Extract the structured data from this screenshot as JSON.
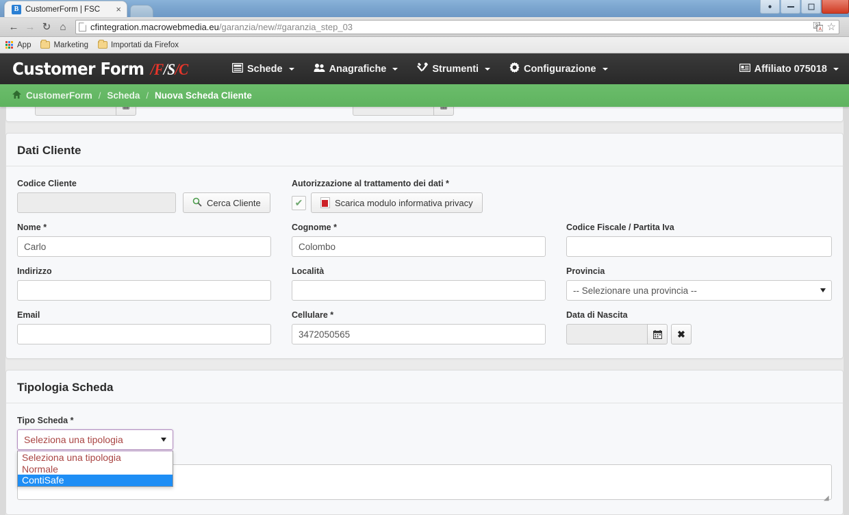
{
  "browser": {
    "tab": {
      "title": "CustomerForm | FSC",
      "favicon_letter": "B",
      "close_label": "×"
    },
    "nav": {
      "back": "←",
      "forward": "→",
      "reload": "↻",
      "home": "⌂"
    },
    "url": {
      "domain": "cfintegration.macrowebmedia.eu",
      "path": "/garanzia/new/#garanzia_step_03"
    },
    "omni_icons": {
      "translate": "translate-icon",
      "star": "☆"
    },
    "bookmarks": [
      {
        "label": "App",
        "icon": "apps-grid-icon"
      },
      {
        "label": "Marketing",
        "icon": "folder-icon"
      },
      {
        "label": "Importati da Firefox",
        "icon": "folder-icon"
      }
    ],
    "window_controls": {
      "person": "●",
      "minimize": "minimize-icon",
      "maximize": "maximize-icon",
      "close": "×"
    }
  },
  "app": {
    "brand": {
      "name": "Customer Form",
      "f": "/F",
      "s": "/S",
      "c": "/C"
    },
    "nav_items": [
      {
        "label": "Schede",
        "icon": "cards-icon",
        "has_caret": true
      },
      {
        "label": "Anagrafiche",
        "icon": "users-icon",
        "has_caret": true
      },
      {
        "label": "Strumenti",
        "icon": "tools-icon",
        "has_caret": true
      },
      {
        "label": "Configurazione",
        "icon": "gear-icon",
        "has_caret": true
      }
    ],
    "user_menu": {
      "label": "Affiliato 075018",
      "icon": "id-card-icon"
    },
    "breadcrumb": [
      {
        "label": "CustomerForm",
        "active": false
      },
      {
        "label": "Scheda",
        "active": false
      },
      {
        "label": "Nuova Scheda Cliente",
        "active": true
      }
    ],
    "breadcrumb_separator": "/"
  },
  "dati_cliente": {
    "title": "Dati Cliente",
    "codice_cliente": {
      "label": "Codice Cliente",
      "value": "",
      "placeholder": ""
    },
    "cerca_cliente_button": "Cerca Cliente",
    "autorizzazione": {
      "label": "Autorizzazione al trattamento dei dati *",
      "checked": true,
      "check_glyph": "✔"
    },
    "scarica_button": "Scarica modulo informativa privacy",
    "nome": {
      "label": "Nome *",
      "value": "Carlo"
    },
    "cognome": {
      "label": "Cognome *",
      "value": "Colombo"
    },
    "codice_fiscale": {
      "label": "Codice Fiscale / Partita Iva",
      "value": ""
    },
    "indirizzo": {
      "label": "Indirizzo",
      "value": ""
    },
    "localita": {
      "label": "Località",
      "value": ""
    },
    "provincia": {
      "label": "Provincia",
      "selected": "-- Selezionare una provincia --"
    },
    "email": {
      "label": "Email",
      "value": ""
    },
    "cellulare": {
      "label": "Cellulare *",
      "value": "3472050565"
    },
    "data_nascita": {
      "label": "Data di Nascita",
      "value": "",
      "calendar_glyph": "▦",
      "clear_glyph": "✖"
    }
  },
  "tipologia_scheda": {
    "title": "Tipologia Scheda",
    "tipo_scheda": {
      "label": "Tipo Scheda *",
      "selected": "Seleziona una tipologia",
      "open": true,
      "options": [
        {
          "label": "Seleziona una tipologia",
          "highlighted": false
        },
        {
          "label": "Normale",
          "highlighted": false
        },
        {
          "label": "ContiSafe",
          "highlighted": true
        }
      ]
    },
    "note": {
      "value": ""
    }
  },
  "clipped_panel": {
    "field_a": {
      "value": "",
      "calendar_glyph": "▦",
      "clear_glyph": "✖"
    },
    "field_b": {
      "value": "",
      "calendar_glyph": "▦",
      "clear_glyph": "✖"
    }
  },
  "colors": {
    "brand_red": "#e8352a",
    "breadcrumb_green": "#6bbd6b",
    "navbar_dark": "#2d2d2d",
    "select_focus_border": "#b48fc0",
    "option_text": "#a94442",
    "highlight_blue": "#1e8ef5"
  }
}
